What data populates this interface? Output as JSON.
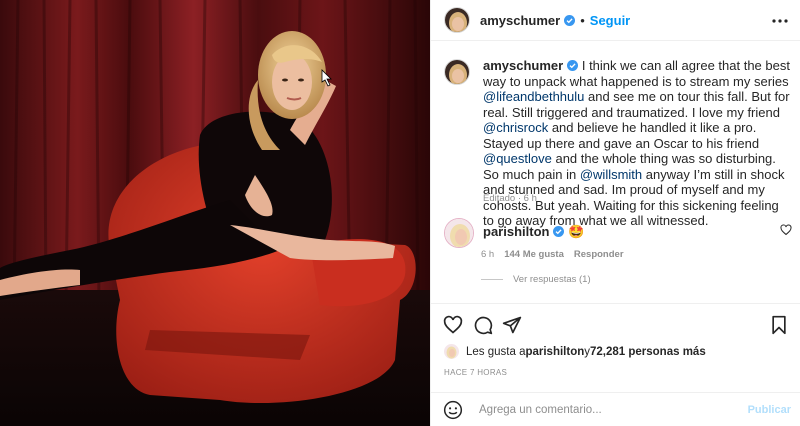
{
  "post": {
    "author": "amyschumer",
    "separator": "•",
    "follow_label": "Seguir",
    "caption_segments": [
      {
        "text": "I think we can all agree that the best way to unpack what happened is to stream my series ",
        "mention": false
      },
      {
        "text": "@lifeandbethhulu",
        "mention": true
      },
      {
        "text": " and see me on tour this fall. But for real. Still triggered and traumatized. I love my friend ",
        "mention": false
      },
      {
        "text": "@chrisrock",
        "mention": true
      },
      {
        "text": " and believe he handled it like a pro. Stayed up there and gave an Oscar to his friend ",
        "mention": false
      },
      {
        "text": "@questlove",
        "mention": true
      },
      {
        "text": " and the whole thing was so disturbing. So much pain in ",
        "mention": false
      },
      {
        "text": "@willsmith",
        "mention": true
      },
      {
        "text": " anyway I’m still in shock and stunned and sad. Im proud of myself and my cohosts. But yeah. Waiting for this sickening feeling to go away from what we all witnessed.",
        "mention": false
      }
    ],
    "edited_label": "Editado · 6 h"
  },
  "comment": {
    "author": "parishilton",
    "emoji": "🤩",
    "time": "6 h",
    "likes": "144 Me gusta",
    "reply_label": "Responder",
    "view_replies": "Ver respuestas (1)"
  },
  "likes_line": {
    "prefix": "Les gusta a ",
    "user": "parishilton",
    "middle": " y ",
    "count": "72,281 personas más"
  },
  "timestamp": "HACE 7 HORAS",
  "add_comment": {
    "placeholder": "Agrega un comentario...",
    "post_label": "Publicar"
  },
  "colors": {
    "link": "#0095f6",
    "mention": "#00376b",
    "muted": "#8e8e8e",
    "verified": "#3897f0",
    "post_disabled": "#b2dffc"
  },
  "icons": {
    "more": "more-horizontal-icon",
    "like": "heart-icon",
    "comment": "comment-icon",
    "share": "paper-plane-icon",
    "save": "bookmark-icon",
    "emoji": "smiley-icon",
    "verified": "verified-badge-icon"
  }
}
